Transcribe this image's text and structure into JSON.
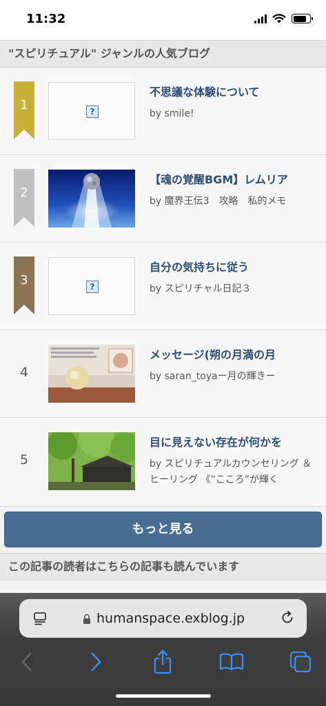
{
  "status_bar": {
    "time": "11:32"
  },
  "ranking_header": "\"スピリチュアル\" ジャンルの人気ブログ",
  "ranking": [
    {
      "rank": "1",
      "title": "不思議な体験について",
      "author": "by smile!",
      "thumbnail": "missing-image",
      "badge_color": "#c9b23a"
    },
    {
      "rank": "2",
      "title": "【魂の覚醒BGM】レムリア",
      "author": "by 魔界王伝3　攻略　私的メモ",
      "thumbnail": "photo",
      "badge_color": "#c0c0c0"
    },
    {
      "rank": "3",
      "title": "自分の気持ちに従う",
      "author": "by スピリチャル日記３",
      "thumbnail": "missing-image",
      "badge_color": "#8a7252"
    },
    {
      "rank": "4",
      "title": "メッセージ(朔の月満の月",
      "author": "by saran_toyaー月の輝きー",
      "thumbnail": "photo"
    },
    {
      "rank": "5",
      "title": "目に見えない存在が何かを",
      "author": "by スピリチュアルカウンセリング ＆ ヒーリング 《”こころ”が輝く",
      "thumbnail": "photo"
    }
  ],
  "missing_image_glyph": "?",
  "more_button": "もっと見る",
  "related_header": "この記事の読者はこちらの記事も読んでいます",
  "browser": {
    "url": "humanspace.exblog.jp",
    "icons": [
      "tabs-overview-icon",
      "lock-icon",
      "reload-icon",
      "back-icon",
      "forward-icon",
      "share-icon",
      "bookmarks-icon",
      "tabs-icon"
    ]
  }
}
